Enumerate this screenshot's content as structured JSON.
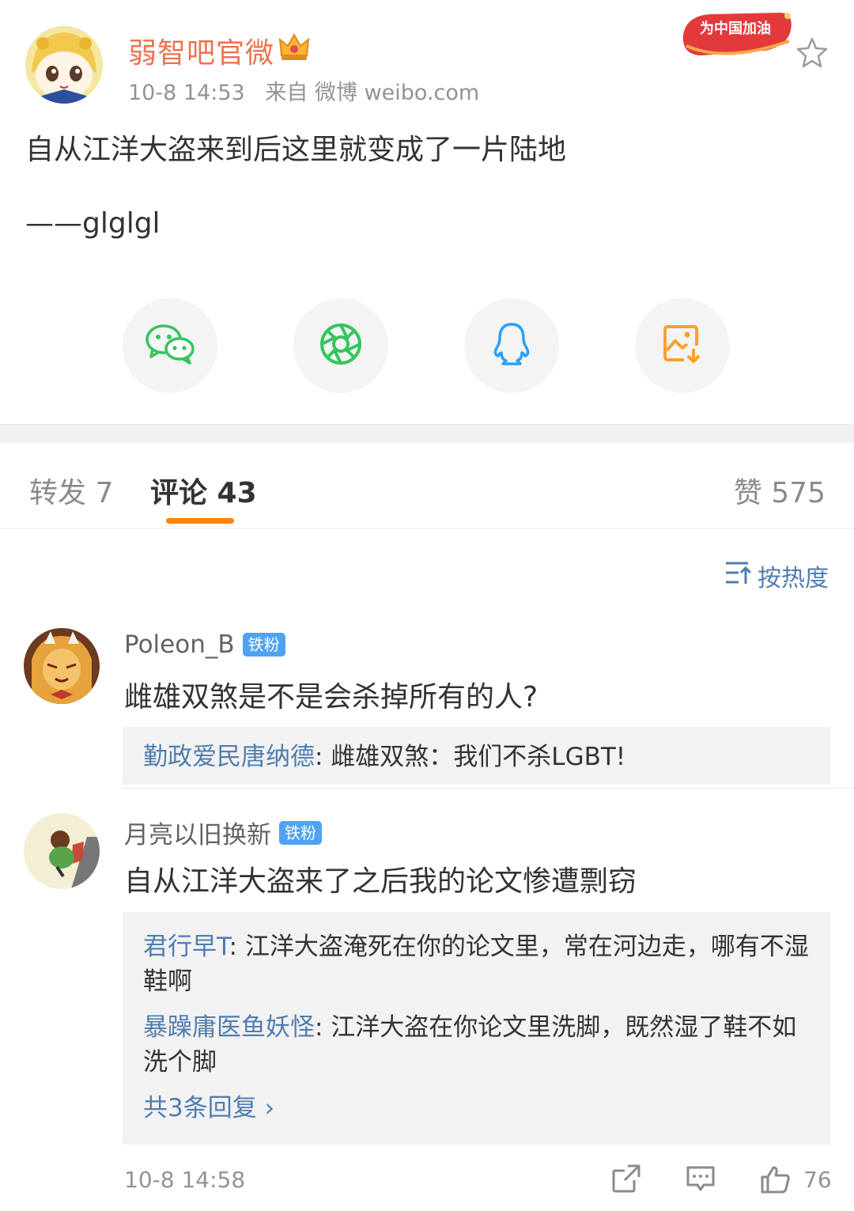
{
  "post": {
    "author": "弱智吧官微",
    "time": "10-8 14:53",
    "source": "来自 微博 weibo.com",
    "badge_text": "为中国加油",
    "text": "自从江洋大盗来到后这里就变成了一片陆地",
    "signature": "——glglgl"
  },
  "share": [
    {
      "name": "wechat-icon",
      "color": "#35c55e"
    },
    {
      "name": "moments-icon",
      "color": "#35c55e"
    },
    {
      "name": "qq-icon",
      "color": "#2ea0f5"
    },
    {
      "name": "save-image-icon",
      "color": "#f7a22a"
    }
  ],
  "tabs": {
    "repost": "转发 7",
    "comment": "评论 43",
    "like": "赞 575"
  },
  "sort_label": "按热度",
  "comments": [
    {
      "user": "Poleon_B",
      "badge": "铁粉",
      "text": "雌雄双煞是不是会杀掉所有的人?",
      "replies": [
        {
          "user": "勤政爱民唐纳德",
          "text": ": 雌雄双煞：我们不杀LGBT!"
        }
      ]
    },
    {
      "user": "月亮以旧换新",
      "badge": "铁粉",
      "text": "自从江洋大盗来了之后我的论文惨遭剽窃",
      "replies": [
        {
          "user": "君行早T",
          "text": ": 江洋大盗淹死在你的论文里，常在河边走，哪有不湿鞋啊"
        },
        {
          "user": "暴躁庸医鱼妖怪",
          "text": ": 江洋大盗在你论文里洗脚，既然湿了鞋不如洗个脚"
        }
      ],
      "more": "共3条回复 ›",
      "time": "10-8 14:58",
      "likes": "76"
    }
  ]
}
